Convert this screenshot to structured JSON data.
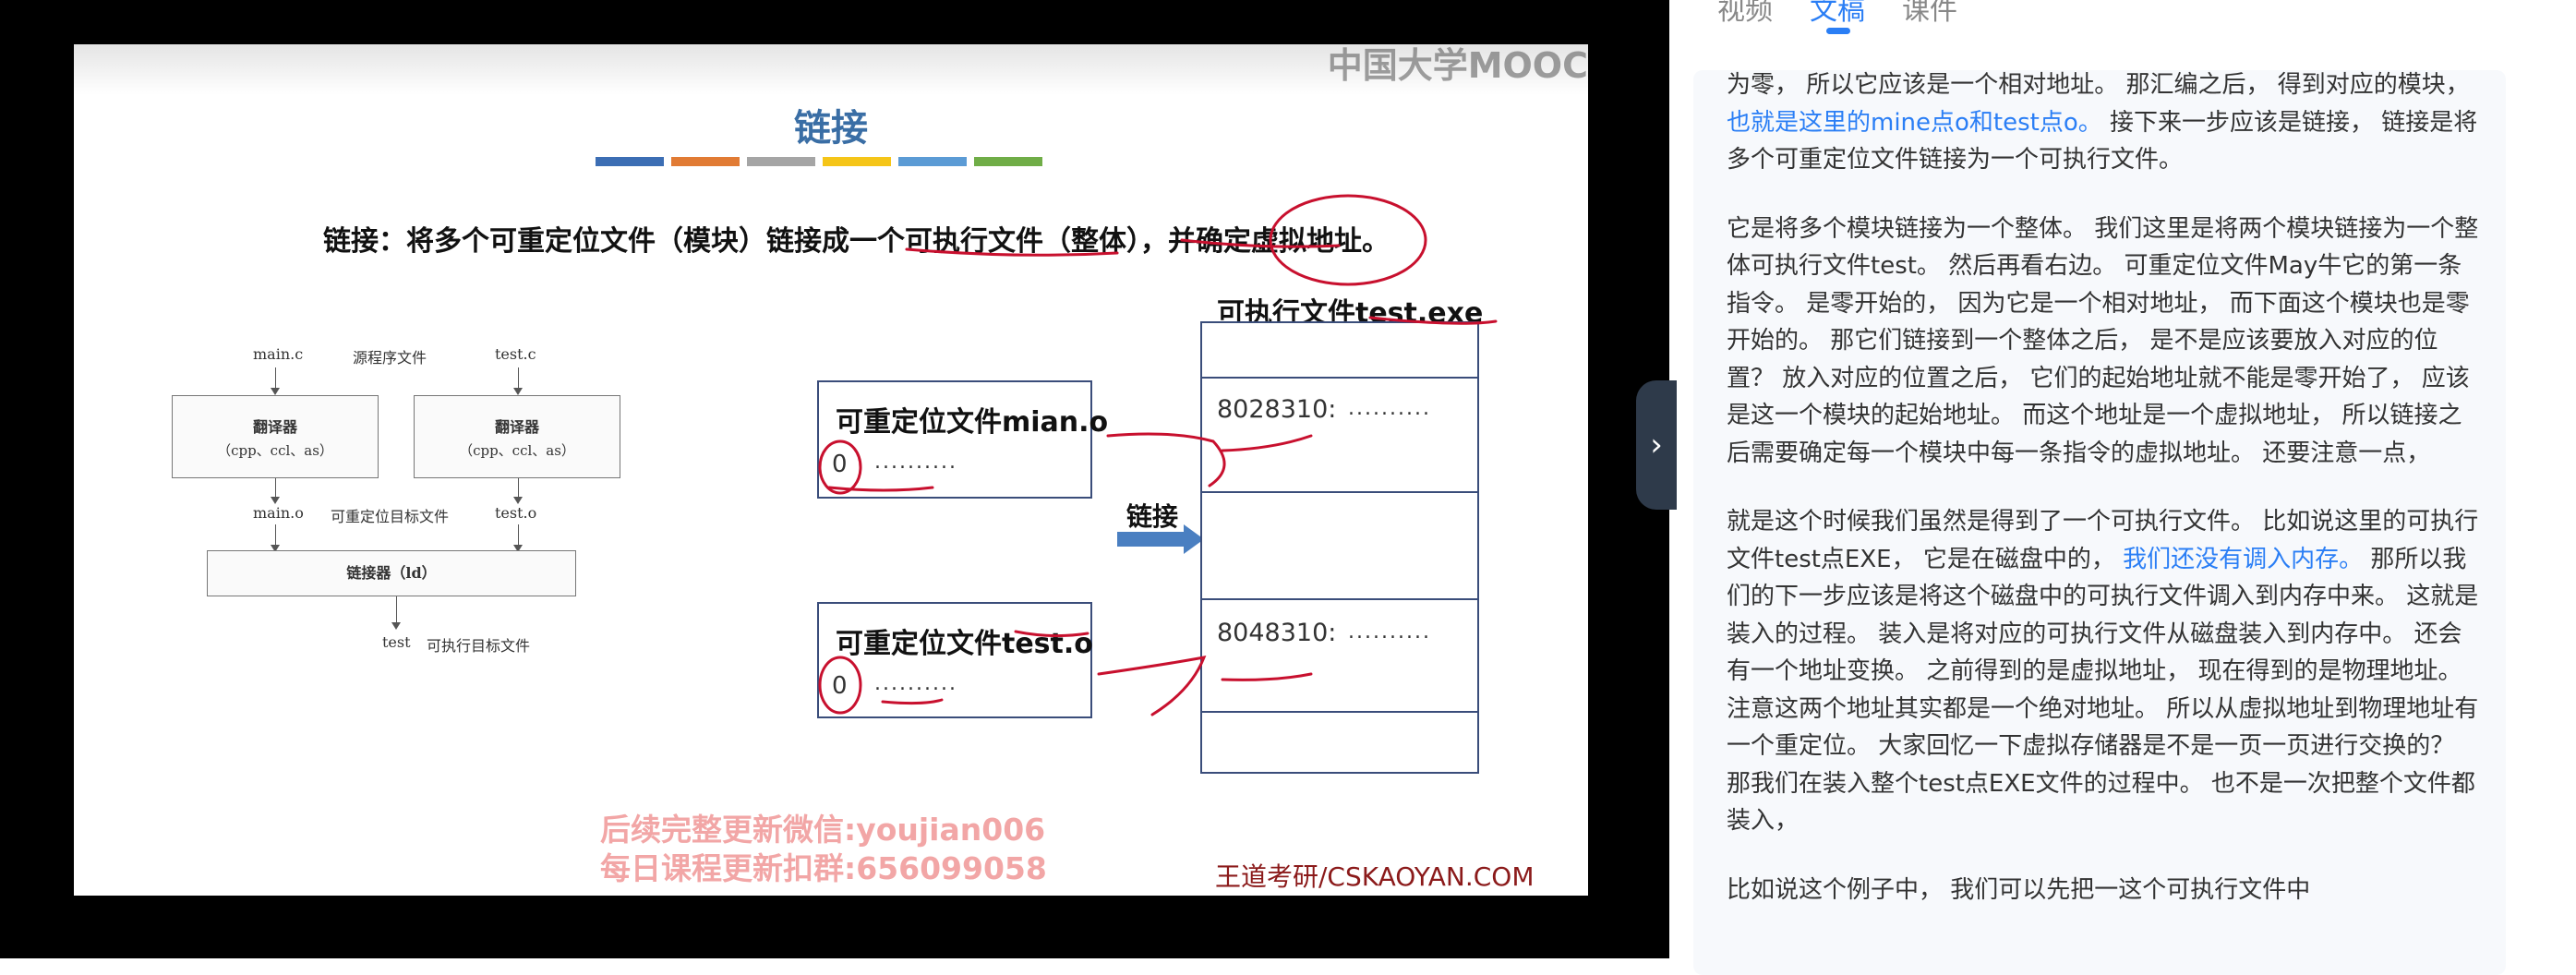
{
  "video": {
    "watermark": "中国大学MOOC",
    "slide": {
      "title": "链接",
      "accent_colors": [
        "#3c6eb4",
        "#e17b34",
        "#a5a5a5",
        "#f5c518",
        "#5b9bd5",
        "#70ad47"
      ],
      "definition": "链接：将多个可重定位文件（模块）链接成一个可执行文件（整体），并确定虚拟地址。",
      "compile_diagram": {
        "source_c1": "main.c",
        "source_label": "源程序文件",
        "source_c2": "test.c",
        "compiler_title": "翻译器",
        "compiler_sub": "（cpp、ccl、as）",
        "obj_o1": "main.o",
        "obj_label": "可重定位目标文件",
        "obj_o2": "test.o",
        "linker_label": "链接器（ld）",
        "output_name": "test",
        "output_label": "可执行目标文件"
      },
      "module1": {
        "title": "可重定位文件mian.o",
        "offset": "0",
        "dots": ".........."
      },
      "module2": {
        "title": "可重定位文件test.o",
        "offset": "0",
        "dots": ".........."
      },
      "link_label": "链接",
      "exe_title": "可执行文件test.exe",
      "exe_row1": {
        "address": "8028310:",
        "dots": ".........."
      },
      "exe_row2": {
        "address": "8048310:",
        "dots": ".........."
      },
      "promo_line1": "后续完整更新微信:youjian006",
      "promo_line2": "每日课程更新扣群:656099058",
      "brand": "王道考研/CSKAOYAN.COM"
    }
  },
  "panel": {
    "expand_icon": "chevron-right-icon",
    "tabs": [
      {
        "label": "视频",
        "active": false
      },
      {
        "label": "文稿",
        "active": true
      },
      {
        "label": "课件",
        "active": false
      }
    ],
    "transcript": {
      "p1a": "为零， 所以它应该是一个相对地址。 那汇编之后， 得到对应的模块， ",
      "p1_hl": "也就是这里的mine点o和test点o。",
      "p1b": " 接下来一步应该是链接， 链接是将多个可重定位文件链接为一个可执行文件。",
      "p2": "它是将多个模块链接为一个整体。 我们这里是将两个模块链接为一个整体可执行文件test。 然后再看右边。 可重定位文件May牛它的第一条指令。 是零开始的， 因为它是一个相对地址， 而下面这个模块也是零开始的。 那它们链接到一个整体之后， 是不是应该要放入对应的位置？ 放入对应的位置之后， 它们的起始地址就不能是零开始了， 应该是这一个模块的起始地址。 而这个地址是一个虚拟地址， 所以链接之后需要确定每一个模块中每一条指令的虚拟地址。 还要注意一点，",
      "p3a": "就是这个时候我们虽然是得到了一个可执行文件。 比如说这里的可执行文件test点EXE， 它是在磁盘中的， ",
      "p3_hl": "我们还没有调入内存。",
      "p3b": " 那所以我们的下一步应该是将这个磁盘中的可执行文件调入到内存中来。 这就是装入的过程。 装入是将对应的可执行文件从磁盘装入到内存中。 还会有一个地址变换。 之前得到的是虚拟地址， 现在得到的是物理地址。 注意这两个地址其实都是一个绝对地址。 所以从虚拟地址到物理地址有一个重定位。 大家回忆一下虚拟存储器是不是一页一页进行交换的？ 那我们在装入整个test点EXE文件的过程中。 也不是一次把整个文件都装入，",
      "p4": "比如说这个例子中， 我们可以先把一这个可执行文件中"
    }
  }
}
